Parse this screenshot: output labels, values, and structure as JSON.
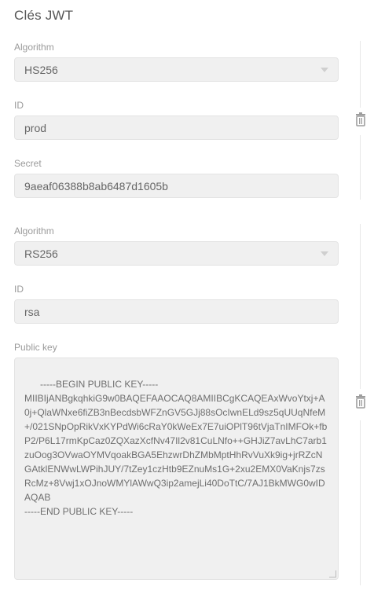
{
  "header": {
    "title": "Clés JWT"
  },
  "keys": [
    {
      "algorithm_label": "Algorithm",
      "algorithm_value": "HS256",
      "id_label": "ID",
      "id_value": "prod",
      "secret_label": "Secret",
      "secret_value": "9aeaf06388b8ab6487d1605b",
      "delete_icon": "trash-icon"
    },
    {
      "algorithm_label": "Algorithm",
      "algorithm_value": "RS256",
      "id_label": "ID",
      "id_value": "rsa",
      "public_key_label": "Public key",
      "public_key_value": "-----BEGIN PUBLIC KEY-----\nMIIBIjANBgkqhkiG9w0BAQEFAAOCAQ8AMIIBCgKCAQEAxWvoYtxj+A0j+QlaWNxe6fiZB3nBecdsbWFZnGV5GJj88sOcIwnELd9sz5qUUqNfeM+/021SNpOpRikVxKYPdWi6cRaY0kWeEx7E7uiOPlT96tVjaTnIMFOk+fbP2/P6L17rmKpCaz0ZQXazXcfNv47Il2v81CuLNfo++GHJiZ7avLhC7arb1zuOog3OVwaOYMVqoakBGA5EhzwrDhZMbMptHhRvVuXk9ig+jrRZcNGAtklENWwLWPihJUY/7tZey1czHtb9EZnuMs1G+2xu2EMX0VaKnjs7zsRcMz+8Vwj1xOJnoWMYlAWwQ3ip2amejLi40DoTtC/7AJ1BkMWG0wIDAQAB\n-----END PUBLIC KEY-----",
      "delete_icon": "trash-icon"
    }
  ],
  "colors": {
    "field_bg": "#f0f0f0",
    "label": "#9a9a9a",
    "text": "#666666"
  }
}
